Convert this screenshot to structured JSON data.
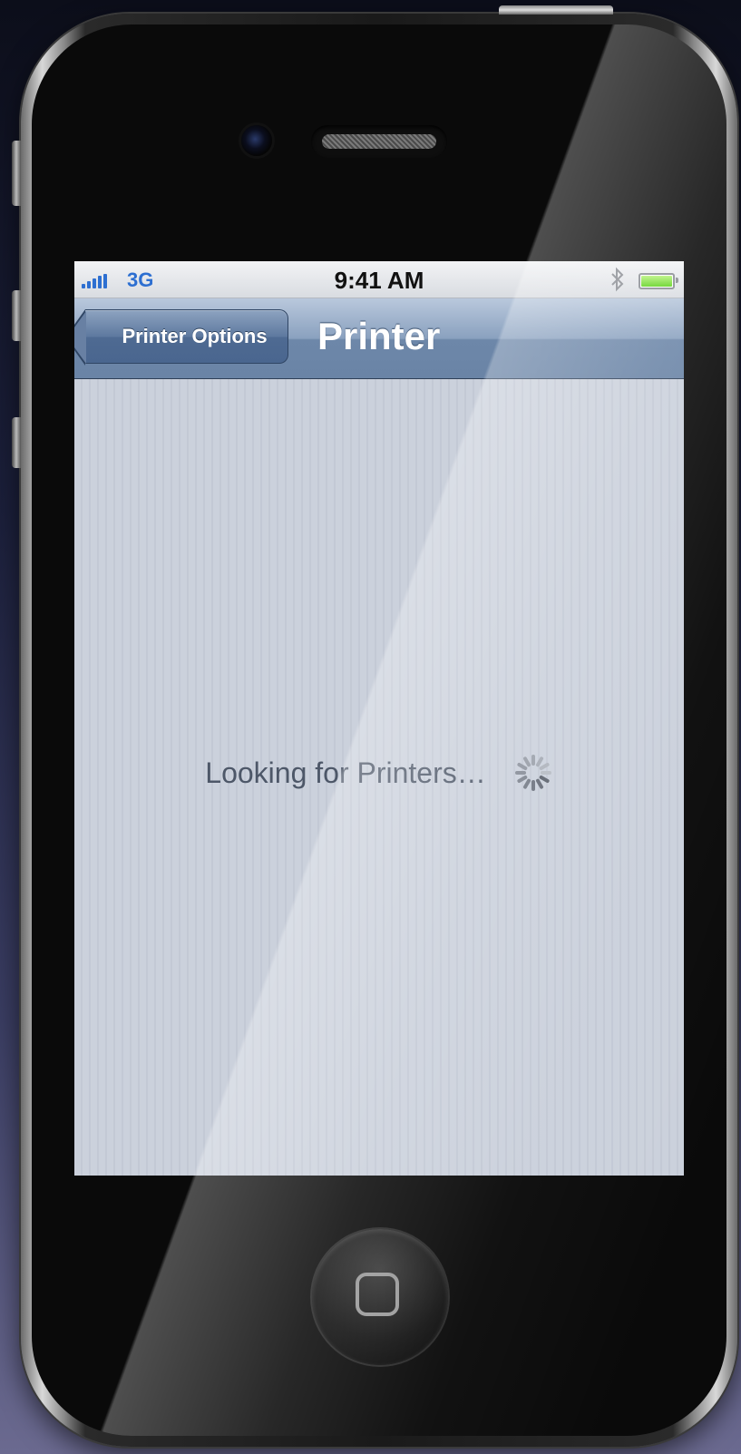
{
  "device": {
    "name": "iPhone"
  },
  "status_bar": {
    "carrier": "3G",
    "time": "9:41 AM",
    "bluetooth_icon": "bluetooth-icon",
    "battery_icon": "battery-icon",
    "battery_color": "#5fd11e"
  },
  "nav_bar": {
    "back_label": "Printer Options",
    "title": "Printer"
  },
  "content": {
    "loading_text": "Looking for Printers…",
    "spinner_icon": "activity-spinner-icon"
  },
  "colors": {
    "nav_blue": "#6d87a9",
    "status_blue": "#2d6fd1",
    "content_bg": "#c9cfda"
  }
}
